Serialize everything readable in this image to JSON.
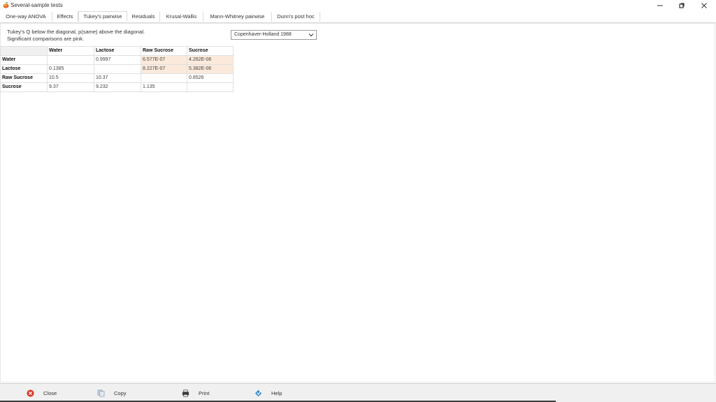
{
  "window": {
    "title": "Several-sample tests",
    "controls": {
      "minimize": "minimize-icon",
      "maximize": "maximize-icon",
      "close": "close-icon"
    }
  },
  "tabs": [
    {
      "label": "One-way ANOVA",
      "active": false
    },
    {
      "label": "Effects",
      "active": false
    },
    {
      "label": "Tukey's pairwise",
      "active": true
    },
    {
      "label": "Residuals",
      "active": false
    },
    {
      "label": "Krusal-Wallis",
      "active": false
    },
    {
      "label": "Mann-Whitney pairwise",
      "active": false
    },
    {
      "label": "Dunn's post hoc",
      "active": false
    }
  ],
  "description": {
    "line1": "Tukey's Q below the diagonal, p(same) above the diagonal.",
    "line2": "Significant comparisons are pink."
  },
  "method_select": {
    "value": "Copenhaver-Holland 1988"
  },
  "table": {
    "columns": [
      "Water",
      "Lactose",
      "Raw Sucrose",
      "Sucrose"
    ],
    "rows": [
      {
        "label": "Water",
        "cells": [
          "",
          "0.9997",
          "6.577E-07",
          "4.262E-06"
        ],
        "pink": [
          false,
          false,
          true,
          true
        ]
      },
      {
        "label": "Lactose",
        "cells": [
          "0.1385",
          "",
          "8.227E-07",
          "5.382E-06"
        ],
        "pink": [
          false,
          false,
          true,
          true
        ]
      },
      {
        "label": "Raw Sucrose",
        "cells": [
          "10.5",
          "10.37",
          "",
          "0.8526"
        ],
        "pink": [
          false,
          false,
          false,
          false
        ]
      },
      {
        "label": "Sucrose",
        "cells": [
          "9.37",
          "9.232",
          "1.135",
          ""
        ],
        "pink": [
          false,
          false,
          false,
          false
        ]
      }
    ],
    "highlight_color": "#fbeadb"
  },
  "bottom_buttons": {
    "close": {
      "label": "Close",
      "icon": "close-circle-icon"
    },
    "copy": {
      "label": "Copy",
      "icon": "copy-icon"
    },
    "print": {
      "label": "Print",
      "icon": "printer-icon"
    },
    "help": {
      "label": "Help",
      "icon": "help-icon"
    }
  }
}
